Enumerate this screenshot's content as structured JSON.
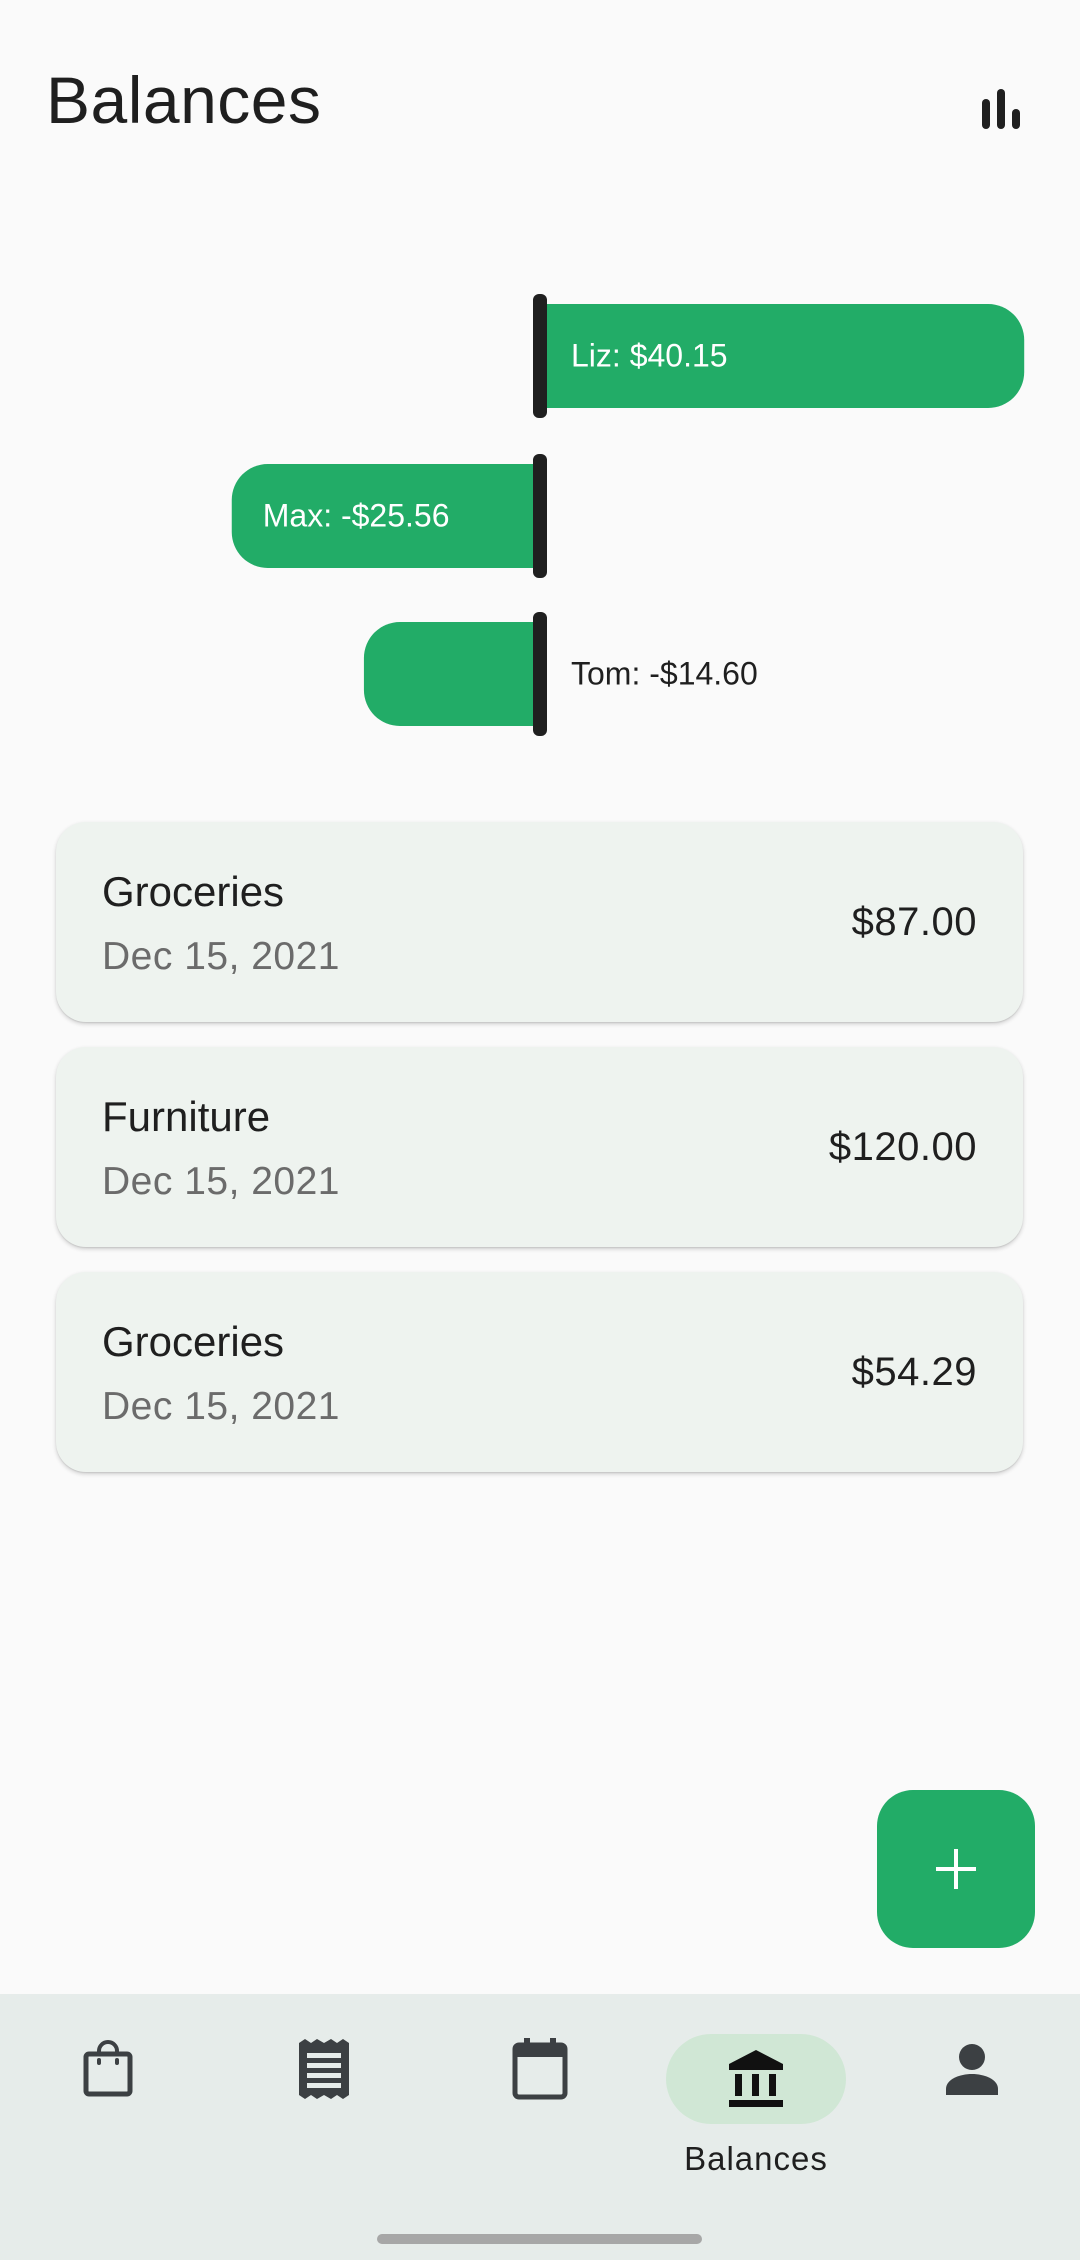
{
  "header": {
    "title": "Balances",
    "chart_icon": "bar-chart-icon"
  },
  "colors": {
    "accent": "#22ac67",
    "bar_text_on_bar": "#ffffff",
    "axis": "#1f1f1f",
    "card_bg": "#eef3ef",
    "nav_bg": "#e6ecea",
    "nav_active_pill": "#d0e7d5"
  },
  "chart_data": {
    "type": "bar",
    "orientation": "horizontal",
    "categories": [
      "Liz",
      "Max",
      "Tom"
    ],
    "values": [
      40.15,
      -25.56,
      -14.6
    ],
    "labels": [
      "Liz: $40.15",
      "Max: -$25.56",
      "Tom: -$14.60"
    ],
    "baseline": 0,
    "grid": false,
    "legend": "none"
  },
  "expenses": [
    {
      "title": "Groceries",
      "date": "Dec 15, 2021",
      "amount": "$87.00"
    },
    {
      "title": "Furniture",
      "date": "Dec 15, 2021",
      "amount": "$120.00"
    },
    {
      "title": "Groceries",
      "date": "Dec 15, 2021",
      "amount": "$54.29"
    }
  ],
  "fab": {
    "icon": "plus-icon"
  },
  "nav": {
    "items": [
      {
        "id": "shopping",
        "icon": "shopping-bag-icon",
        "label": ""
      },
      {
        "id": "receipts",
        "icon": "receipt-icon",
        "label": ""
      },
      {
        "id": "calendar",
        "icon": "calendar-icon",
        "label": ""
      },
      {
        "id": "balances",
        "icon": "bank-icon",
        "label": "Balances",
        "active": true
      },
      {
        "id": "profile",
        "icon": "person-icon",
        "label": ""
      }
    ]
  }
}
